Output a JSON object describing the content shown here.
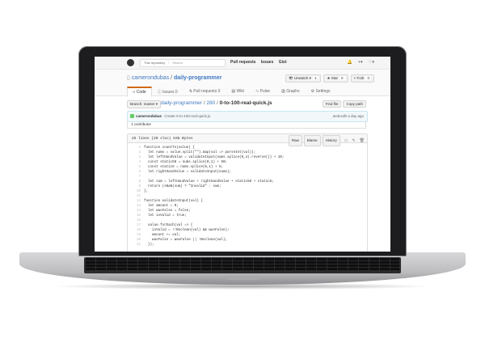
{
  "topbar": {
    "search_scope": "This repository",
    "search_placeholder": "Search",
    "nav": [
      "Pull requests",
      "Issues",
      "Gist"
    ],
    "icons": [
      "bell-icon",
      "plus-icon",
      "avatar-icon"
    ]
  },
  "repo": {
    "owner": "camerondubas",
    "name": "daily-programmer",
    "watch_label": "Unwatch",
    "watch_count": "1",
    "star_label": "Star",
    "star_count": "0",
    "fork_label": "Fork",
    "fork_count": "0",
    "tabs": [
      {
        "label": "Code",
        "icon": "code-icon",
        "selected": true
      },
      {
        "label": "Issues",
        "count": "0",
        "icon": "issue-icon"
      },
      {
        "label": "Pull requests",
        "count": "0",
        "icon": "pr-icon"
      },
      {
        "label": "Wiki",
        "icon": "book-icon"
      },
      {
        "label": "Pulse",
        "icon": "pulse-icon"
      },
      {
        "label": "Graphs",
        "icon": "graph-icon"
      },
      {
        "label": "Settings",
        "icon": "gear-icon"
      }
    ]
  },
  "file": {
    "branch_label": "Branch: master",
    "breadcrumb_repo": "daily-programmer",
    "breadcrumb_dir": "280",
    "breadcrumb_file": "0-to-100-real-quick.js",
    "find_file": "Find file",
    "copy_path": "Copy path",
    "commit_user": "camerondubas",
    "commit_msg": "Create 0-to-100-real-quick.js",
    "commit_meta": "ae3ecdb a day ago",
    "contributors": "1 contributor",
    "info": "25 lines (20 sloc)   638 Bytes",
    "raw": "Raw",
    "blame": "Blame",
    "history": "History"
  },
  "code_lines": [
    "function countTo(value) {",
    "  let nums = value.split(\"\").map(val => parseInt(val));",
    "  let leftHandValue = validateInput(nums.splice(0,4).reverse()) + 10;",
    "  const static50 = nums.splice(0,1) + 50;",
    "  const static5 = nums.splice(0,1) + 5;",
    "  let rightHandValue = validateInput(nums);",
    "",
    "  let sum = leftHandValue + rightHandValue + static50 + static5;",
    "  return (sNaN(sum) ? \"Invalid\" : sum;",
    "};",
    "",
    "function validateInput(val) {",
    "  let amount = 0;",
    "  let wasFalse = false;",
    "  let isValid = true;",
    "",
    "  value.forEach(val => {",
    "    isValid = !!Boolean(val) && wasFalse);",
    "    amount += val;",
    "    wasFalse = wasFalse || !Boolean(val);",
    "  });"
  ]
}
